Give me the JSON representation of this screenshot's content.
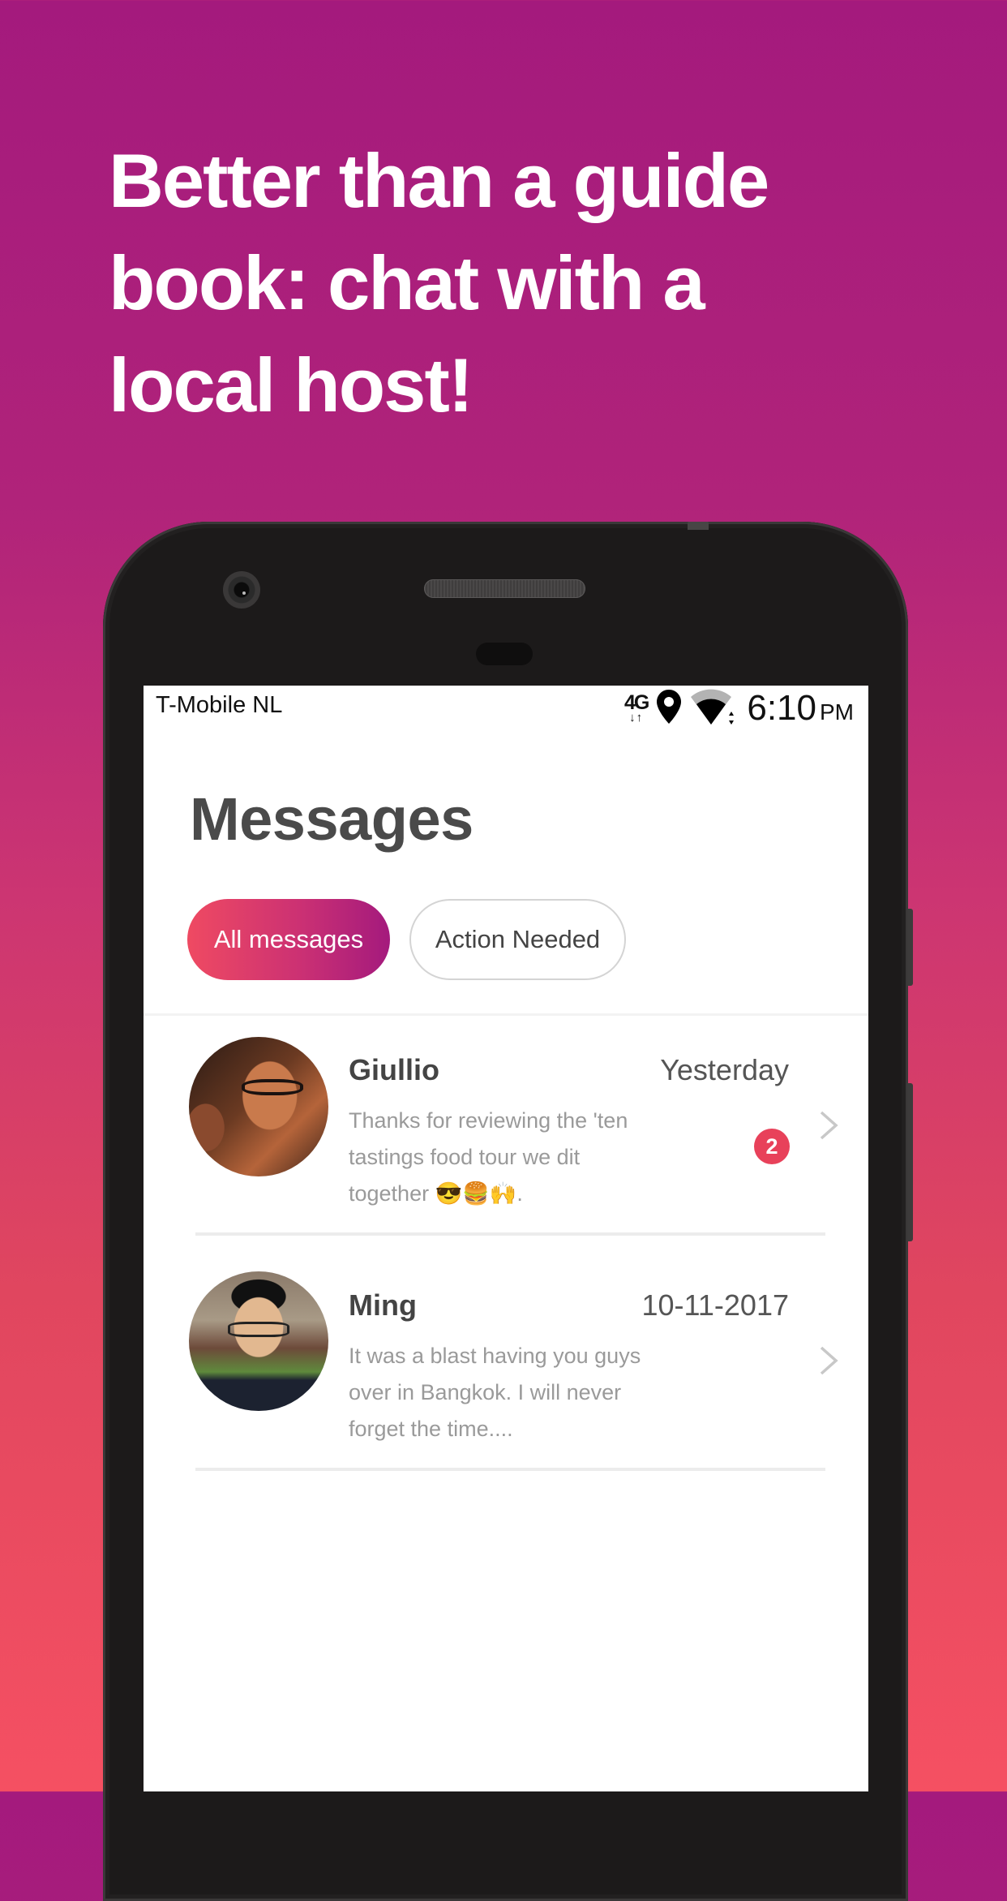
{
  "headline": {
    "lines": [
      "Better than a guide",
      "book: chat with a",
      "local host!"
    ]
  },
  "status_bar": {
    "carrier": "T-Mobile NL",
    "network": "4G",
    "network_arrows": "↓↑",
    "time": "6:10",
    "ampm": "PM",
    "icons": [
      "4g-data-icon",
      "location-pin-icon",
      "wifi-signal-icon"
    ]
  },
  "page": {
    "title": "Messages"
  },
  "tabs": [
    {
      "label": "All messages",
      "active": true
    },
    {
      "label": "Action Needed",
      "active": false
    }
  ],
  "messages": [
    {
      "name": "Giullio",
      "date": "Yesterday",
      "preview": "Thanks for reviewing the 'ten tastings food tour we dit together 😎🍔🙌.",
      "unread_count": "2"
    },
    {
      "name": "Ming",
      "date": "10-11-2017",
      "preview": "It was a blast having you guys over in Bangkok. I will never forget the time....",
      "unread_count": null
    }
  ],
  "colors": {
    "accent_start": "#ef4a62",
    "accent_end": "#a41a7d",
    "badge": "#e8415a",
    "background_top": "#a41a7d",
    "background_bottom": "#f55062"
  }
}
